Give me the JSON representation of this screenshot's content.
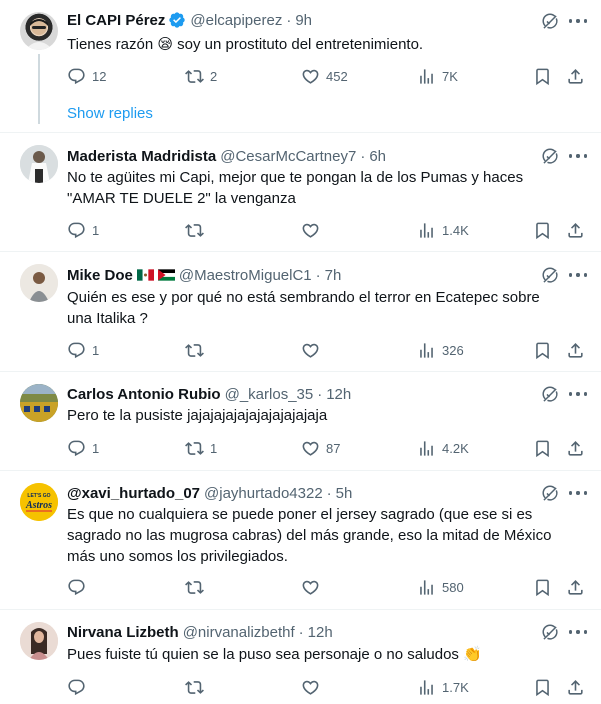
{
  "tweets": [
    {
      "name": "El CAPI Pérez",
      "handle": "@elcapiperez",
      "dot": "·",
      "time": "9h",
      "verified": true,
      "text": "Tienes razón 😪 soy un prostituto del entretenimiento.",
      "replies": "12",
      "retweets": "2",
      "likes": "452",
      "views": "7K"
    },
    {
      "name": "Maderista Madridista",
      "handle": "@CesarMcCartney7",
      "dot": "·",
      "time": "6h",
      "text": "No te agüites mi Capi, mejor que te pongan la de los Pumas y haces \"AMAR TE DUELE 2\" la venganza",
      "replies": "1",
      "retweets": "",
      "likes": "",
      "views": "1.4K"
    },
    {
      "name": "Mike Doe",
      "handle": "@MaestroMiguelC1",
      "dot": "·",
      "time": "7h",
      "flags": [
        "mexico-flag",
        "palestine-flag"
      ],
      "text": "Quién es ese y por qué no está sembrando el terror en Ecatepec sobre una Italika ?",
      "replies": "1",
      "retweets": "",
      "likes": "",
      "views": "326"
    },
    {
      "name": "Carlos Antonio Rubio",
      "handle": "@_karlos_35",
      "dot": "·",
      "time": "12h",
      "text": "Pero te la pusiste jajajajajajajajajajajaja",
      "replies": "1",
      "retweets": "1",
      "likes": "87",
      "views": "4.2K"
    },
    {
      "name": "@xavi_hurtado_07",
      "handle": "@jayhurtado4322",
      "dot": "·",
      "time": "5h",
      "text": "Es que no cualquiera se puede poner el jersey sagrado (que ese si es sagrado no las mugrosa cabras) del más grande, eso la mitad de México más uno somos los privilegiados.",
      "replies": "",
      "retweets": "",
      "likes": "",
      "views": "580"
    },
    {
      "name": "Nirvana Lizbeth",
      "handle": "@nirvanalizbethf",
      "dot": "·",
      "time": "12h",
      "text": "Pues fuiste tú quien se la puso sea personaje o no saludos 👏",
      "replies": "",
      "retweets": "",
      "likes": "",
      "views": "1.7K"
    }
  ],
  "show_replies": "Show replies",
  "avatar_badges": {
    "astros_top": "LET'S GO",
    "astros_main": "Astros"
  },
  "colors": {
    "text": "#0f1419",
    "secondary": "#536471",
    "link": "#1d9bf0",
    "separator": "#eff3f4",
    "verified": "#1d9bf0"
  },
  "icons": [
    "grok-icon",
    "more-icon",
    "reply-icon",
    "retweet-icon",
    "like-icon",
    "views-icon",
    "bookmark-icon",
    "share-icon",
    "verified-badge-icon"
  ]
}
